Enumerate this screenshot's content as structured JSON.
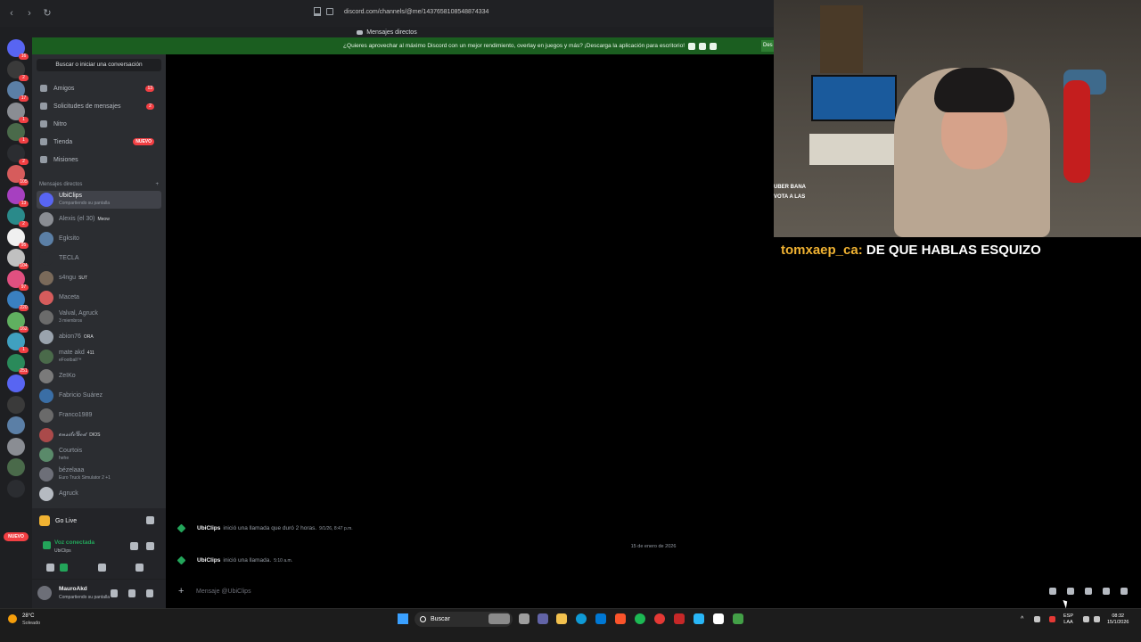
{
  "browser": {
    "url": "discord.com/channels/@me/1437658108548874334"
  },
  "discord": {
    "title": "Mensajes directos",
    "promo_text": "¿Quieres aprovechar al máximo Discord con un mejor rendimiento, overlay en juegos y más? ¡Descarga la aplicación para escritorio!",
    "promo_button": "Des",
    "search_label": "Buscar o iniciar una conversación",
    "nav": [
      {
        "label": "Amigos",
        "badge": "13"
      },
      {
        "label": "Solicitudes de mensajes",
        "badge": "2"
      },
      {
        "label": "Nitro",
        "badge": ""
      },
      {
        "label": "Tienda",
        "badge": "NUEVO"
      },
      {
        "label": "Misiones",
        "badge": ""
      }
    ],
    "dm_header": "Mensajes directos",
    "dm_add": "+",
    "dms": [
      {
        "name": "UbiClips",
        "sub": "Compartiendo su pantalla",
        "tag": ""
      },
      {
        "name": "Alexis (el 30)",
        "sub": "",
        "tag": "Meow"
      },
      {
        "name": "Egksito",
        "sub": "",
        "tag": ""
      },
      {
        "name": "TECLA",
        "sub": "",
        "tag": ""
      },
      {
        "name": "s4ngu",
        "sub": "",
        "tag": "SUT"
      },
      {
        "name": "Maceta",
        "sub": "",
        "tag": ""
      },
      {
        "name": "Valval, Agruck",
        "sub": "3 miembros",
        "tag": ""
      },
      {
        "name": "abion76",
        "sub": "",
        "tag": "ORA"
      },
      {
        "name": "mate akd",
        "sub": "eFootball™",
        "tag": "411"
      },
      {
        "name": "ZeIKo",
        "sub": "",
        "tag": ""
      },
      {
        "name": "Fabricio Suárez",
        "sub": "",
        "tag": ""
      },
      {
        "name": "Franco1989",
        "sub": "",
        "tag": ""
      },
      {
        "name": "𝓮𝓷𝓼𝓲𝓽𝓸𝓖𝓸𝓭",
        "sub": "",
        "tag": "DIOS"
      },
      {
        "name": "Courtois",
        "sub": "hehe",
        "tag": ""
      },
      {
        "name": "bézelaaa",
        "sub": "Euro Truck Simulator 2 +1",
        "tag": ""
      },
      {
        "name": "Agruck",
        "sub": "",
        "tag": ""
      }
    ],
    "server_badges": [
      "16",
      "2",
      "17",
      "1",
      "1",
      "2",
      "105",
      "13",
      "2",
      "95",
      "104",
      "97",
      "220",
      "162",
      "1",
      "251"
    ],
    "server_nuevo": "NUEVO",
    "go_live": "Go Live",
    "voice": {
      "title": "Voz conectada",
      "sub": "UbiClips"
    },
    "user": {
      "name": "MauroAkd",
      "status": "Compartiendo su pantalla"
    },
    "messages": [
      {
        "who": "UbiClips",
        "text": "inició una llamada que duró 2 horas.",
        "ts": "9/1/26, 8:47 p.m."
      },
      {
        "who": "UbiClips",
        "text": "inició una llamada.",
        "ts": "5:10 a.m."
      }
    ],
    "date_divider": "15 de enero de 2026",
    "input_placeholder": "Mensaje @UbiClips"
  },
  "stream": {
    "chat_user": "tomxaep_ca:",
    "chat_message": "DE QUE HABLAS ESQUIZO",
    "overlay_chat_line1": "UBER BANA",
    "overlay_chat_line2": "VOTA A LAS"
  },
  "taskbar": {
    "temp": "28°C",
    "weather": "Soleado",
    "search": "Buscar",
    "lang1": "ESP",
    "lang2": "LAA",
    "time": "08:32",
    "date": "15/1/2026"
  },
  "colors": {
    "promo": "#1b5e20",
    "discord_sidebar": "#2b2d31",
    "accent_green": "#23a55a",
    "badge_red": "#f23f43",
    "chat_user": "#f0b232"
  }
}
